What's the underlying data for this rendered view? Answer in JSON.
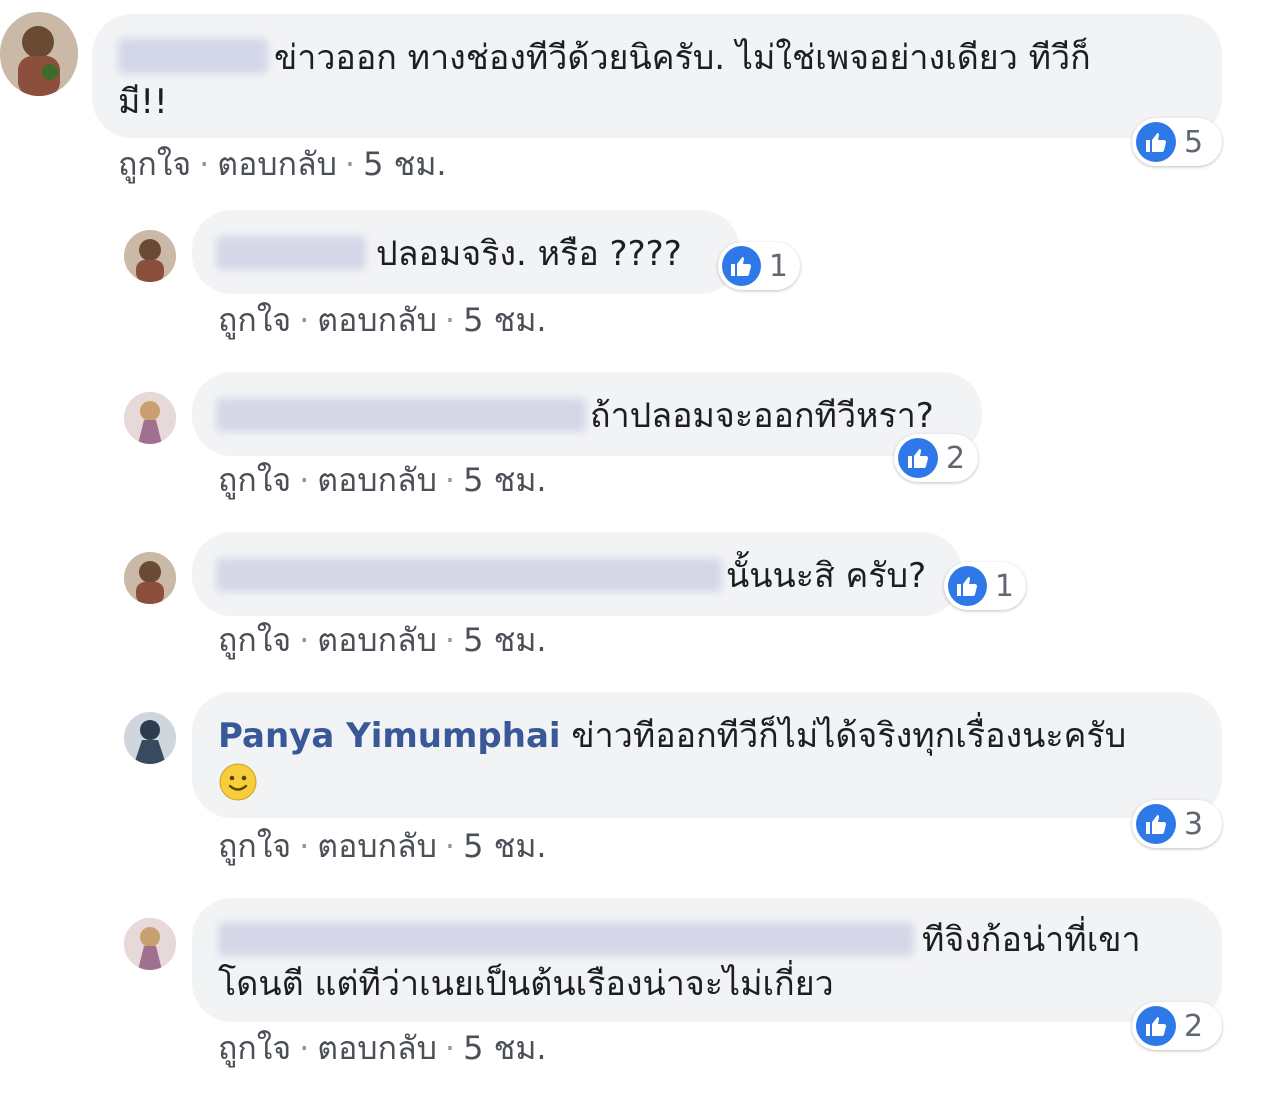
{
  "comments": [
    {
      "text_line1": "ข่าวออก ทางช่องทีวีด้วยนิครับ. ไม่ใช่เพจอย่างเดียว ทีวีก็",
      "text_line2": "มี!!",
      "like_label": "ถูกใจ",
      "reply_label": "ตอบกลับ",
      "time": "5 ชม.",
      "reactions": "5",
      "reaction_color": "#2e78e8"
    },
    {
      "text_line1": "ปลอมจริง. หรือ ????",
      "like_label": "ถูกใจ",
      "reply_label": "ตอบกลับ",
      "time": "5 ชม.",
      "reactions": "1"
    },
    {
      "text_line1": "ถ้าปลอมจะออกทีวีหรา?",
      "like_label": "ถูกใจ",
      "reply_label": "ตอบกลับ",
      "time": "5 ชม.",
      "reactions": "2"
    },
    {
      "text_line1": "นั้นนะสิ ครับ?",
      "like_label": "ถูกใจ",
      "reply_label": "ตอบกลับ",
      "time": "5 ชม.",
      "reactions": "1"
    },
    {
      "author": "Panya Yimumphai",
      "text_line1": "ข่าวทีออกทีวีก็ไม่ได้จริงทุกเรื่องนะครับ",
      "emoji": "smile-emoji",
      "like_label": "ถูกใจ",
      "reply_label": "ตอบกลับ",
      "time": "5 ชม.",
      "reactions": "3"
    },
    {
      "text_line1": "ทีจิงก้อน่าที่เขา",
      "text_line2": "โดนตี แต่ทีว่าเนยเป็นต้นเรืองน่าจะไม่เกี่ยว",
      "like_label": "ถูกใจ",
      "reply_label": "ตอบกลับ",
      "time": "5 ชม.",
      "reactions": "2"
    }
  ],
  "colors": {
    "bubble_bg": "#f2f3f5",
    "link_blue": "#385898",
    "like_blue": "#2e78e8",
    "meta_gray": "#4b4f56"
  }
}
